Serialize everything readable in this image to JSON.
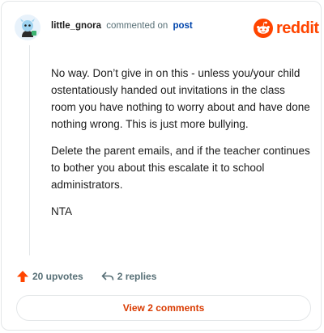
{
  "header": {
    "username": "little_gnora",
    "verb": "commented on",
    "post_link": "post",
    "logo_text": "reddit"
  },
  "comment": {
    "paragraphs": [
      "No way. Don’t give in on this - unless you/your child ostentatiously handed out invitations in the class room you have nothing to worry about and have done nothing wrong. This is just more bullying.",
      "Delete the parent emails, and if the teacher continues to bother you about this escalate it to school administrators.",
      "NTA"
    ]
  },
  "actions": {
    "upvotes_label": "20 upvotes",
    "replies_label": "2 replies"
  },
  "view_comments_label": "View 2 comments",
  "colors": {
    "brand": "#ff4500",
    "link": "#0045ac",
    "button_text": "#d93a00"
  },
  "icons": {
    "upvote": "arrow-up-icon",
    "reply": "reply-arrow-icon",
    "logo": "reddit-snoo-icon"
  }
}
